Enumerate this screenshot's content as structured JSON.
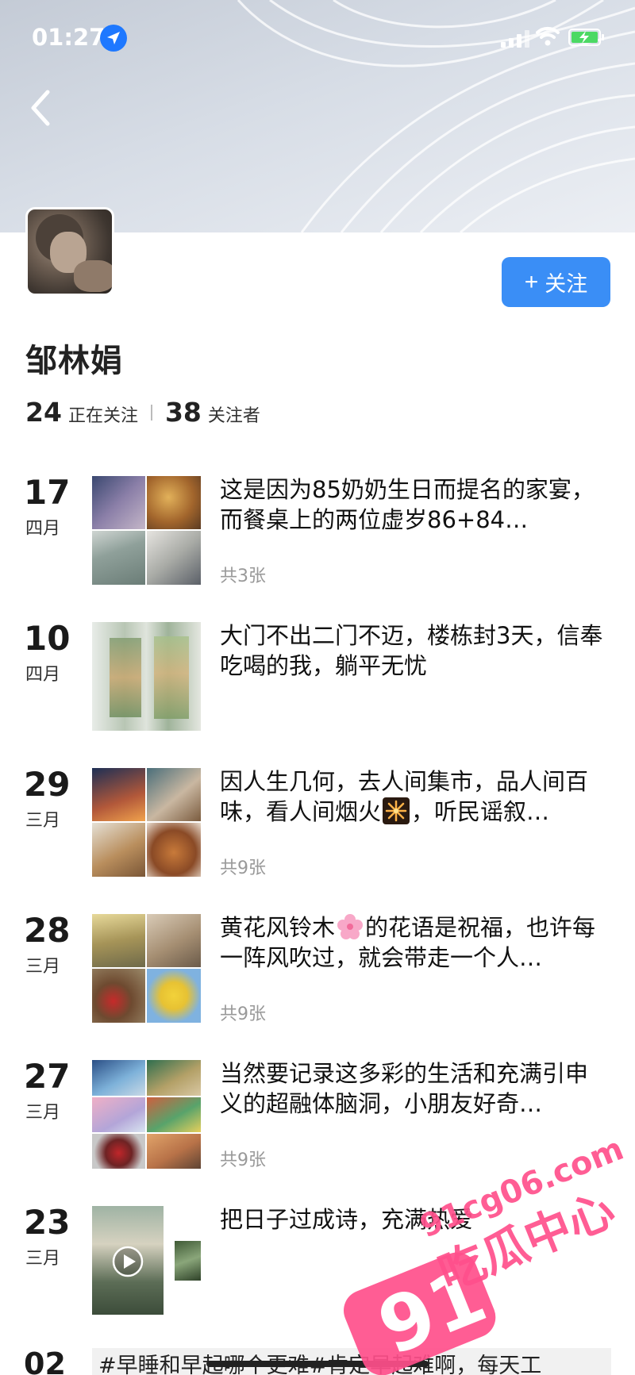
{
  "status_bar": {
    "time": "01:27"
  },
  "profile": {
    "name": "邹林娟",
    "follow_label": "关注",
    "following_count": "24",
    "following_label": "正在关注",
    "followers_count": "38",
    "followers_label": "关注者"
  },
  "posts": [
    {
      "day": "17",
      "month": "四月",
      "text": "这是因为85奶奶生日而提名的家宴，而餐桌上的两位虚岁86+84…",
      "count": "共3张"
    },
    {
      "day": "10",
      "month": "四月",
      "text": "大门不出二门不迈，楼栋封3天，信奉吃喝的我，躺平无忧",
      "count": ""
    },
    {
      "day": "29",
      "month": "三月",
      "text_before": "因人生几何，去人间集市，品人间百味，看人间烟火",
      "text_after": "，听民谣叙…",
      "count": "共9张"
    },
    {
      "day": "28",
      "month": "三月",
      "text_before": "黄花风铃木",
      "text_after": "的花语是祝福，也许每一阵风吹过，就会带走一个人…",
      "count": "共9张"
    },
    {
      "day": "27",
      "month": "三月",
      "text": "当然要记录这多彩的生活和充满引申义的超融体脑洞，小朋友好奇…",
      "count": "共9张"
    },
    {
      "day": "23",
      "month": "三月",
      "text": "把日子过成诗，充满热爱",
      "count": ""
    }
  ],
  "last_post": {
    "day": "02",
    "text": "#早睡和早起哪个更难#肯定早起难啊，每天工"
  },
  "watermark": {
    "number": "91",
    "domain": "91cg06.com",
    "brand": "吃瓜中心"
  },
  "colors": {
    "accent": "#3a8ef6",
    "watermark_pink": "#ff4f8b"
  }
}
